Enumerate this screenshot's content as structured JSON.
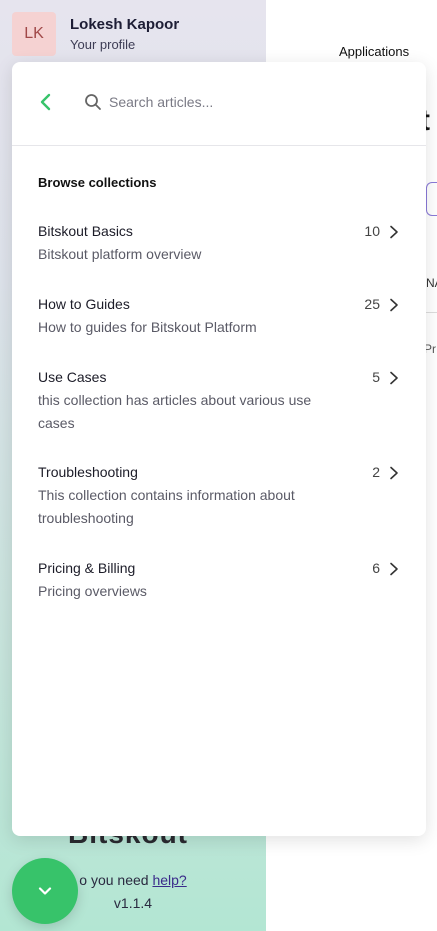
{
  "profile": {
    "initials": "LK",
    "name": "Lokesh Kapoor",
    "subtitle": "Your profile"
  },
  "topnav": {
    "applications_label": "Applications"
  },
  "main": {
    "heading_fragment": "t",
    "na_fragment": "NA",
    "pr_fragment": "Pr"
  },
  "sidebar_footer": {
    "logo_text": "Bitskout",
    "help_prefix": "o you need",
    "help_link": "help?",
    "version": "v1.1.4"
  },
  "help_panel": {
    "search_placeholder": "Search articles...",
    "browse_title": "Browse collections",
    "collections": [
      {
        "title": "Bitskout Basics",
        "description": "Bitskout platform overview",
        "count": "10"
      },
      {
        "title": "How to Guides",
        "description": "How to guides for Bitskout Platform",
        "count": "25"
      },
      {
        "title": "Use Cases",
        "description": "this collection has articles about various use cases",
        "count": "5"
      },
      {
        "title": "Troubleshooting",
        "description": "This collection contains information about troubleshooting",
        "count": "2"
      },
      {
        "title": "Pricing & Billing",
        "description": "Pricing overviews",
        "count": "6"
      }
    ]
  },
  "colors": {
    "accent_green": "#37c36a",
    "avatar_bg": "#f5d2d2",
    "link_purple": "#3a2a8a"
  }
}
